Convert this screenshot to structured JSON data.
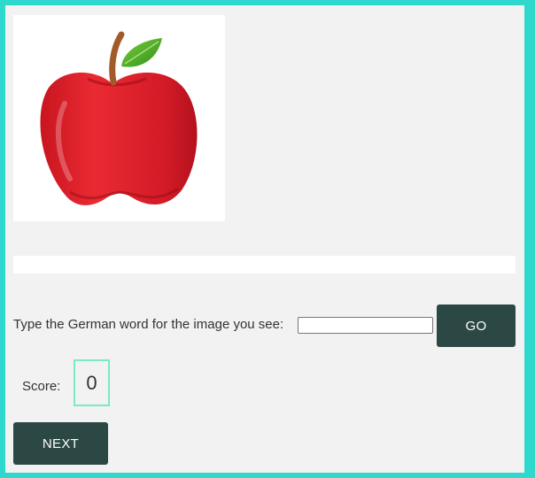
{
  "quiz": {
    "image_alt": "apple",
    "prompt_label": "Type the German word for the image you see:",
    "answer_value": "",
    "go_label": "GO",
    "feedback_text": ""
  },
  "score": {
    "label": "Score:",
    "value": "0"
  },
  "next_label": "NEXT",
  "colors": {
    "outer_border": "#2ed8cc",
    "panel_background": "#f2f2f2",
    "button_background": "#2b4845",
    "score_box_border": "#7be8c9"
  }
}
